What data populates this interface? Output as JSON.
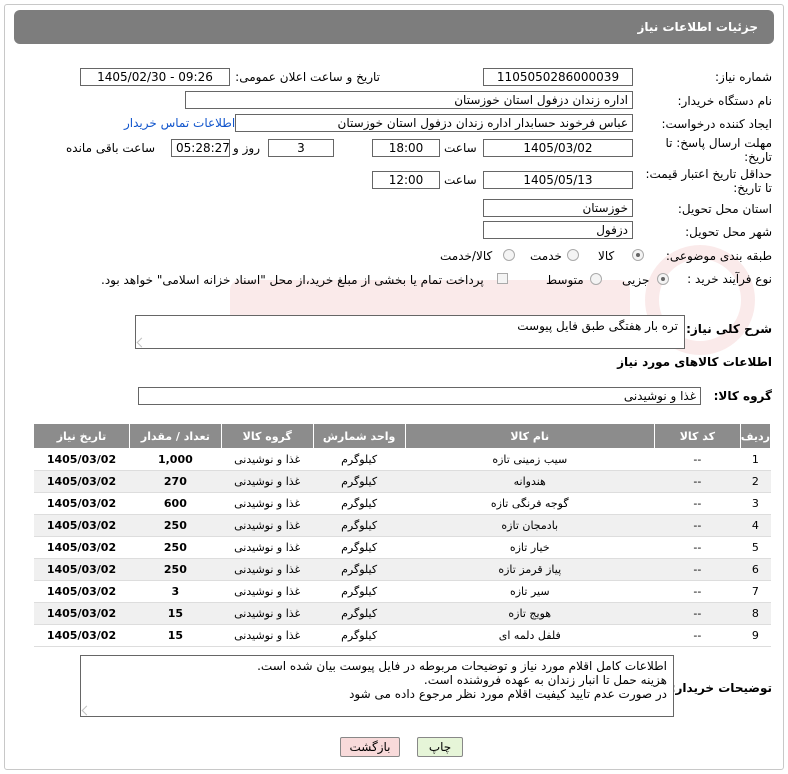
{
  "header": {
    "title": "جزئیات اطلاعات نیاز"
  },
  "fields": {
    "need_number_label": "شماره نیاز:",
    "need_number": "1105050286000039",
    "announce_label": "تاریخ و ساعت اعلان عمومی:",
    "announce_value": "1405/02/30 - 09:26",
    "buyer_label": "نام دستگاه خریدار:",
    "buyer_value": "اداره زندان دزفول استان خوزستان",
    "creator_label": "ایجاد کننده درخواست:",
    "creator_value": "عباس فرخوند حسابدار اداره زندان دزفول استان خوزستان",
    "contact_link": "اطلاعات تماس خریدار",
    "deadline_label_1": "مهلت ارسال پاسخ: تا",
    "deadline_label_2": "تاریخ:",
    "deadline_date": "1405/03/02",
    "time_label": "ساعت",
    "deadline_time": "18:00",
    "days_value": "3",
    "days_label": "روز و",
    "remaining_time": "05:28:27",
    "remaining_label": "ساعت باقی مانده",
    "validity_label_1": "حداقل تاریخ اعتبار قیمت:",
    "validity_label_2": "تا تاریخ:",
    "validity_date": "1405/05/13",
    "validity_time": "12:00",
    "province_label": "استان محل تحویل:",
    "province_value": "خوزستان",
    "city_label": "شهر محل تحویل:",
    "city_value": "دزفول",
    "category_label": "طبقه بندی موضوعی:",
    "category_options": [
      "کالا",
      "خدمت",
      "کالا/خدمت"
    ],
    "category_selected": "کالا",
    "process_label": "نوع فرآیند خرید :",
    "process_options": [
      "جزیی",
      "متوسط"
    ],
    "process_selected": "جزیی",
    "payment_note": "پرداخت تمام یا بخشی از مبلغ خرید،از محل \"اسناد خزانه اسلامی\" خواهد بود."
  },
  "summary": {
    "label": "شرح کلی نیاز:",
    "value": "تره بار هفتگی طبق فایل پیوست"
  },
  "goods_section": {
    "title": "اطلاعات کالاهای مورد نیاز",
    "group_label": "گروه کالا:",
    "group_value": "غذا و نوشیدنی"
  },
  "table": {
    "headers": [
      "ردیف",
      "کد کالا",
      "نام کالا",
      "واحد شمارش",
      "گروه کالا",
      "تعداد / مقدار",
      "تاریخ نیاز"
    ],
    "rows": [
      [
        "1",
        "--",
        "سیب زمینی تازه",
        "کیلوگرم",
        "غذا و نوشیدنی",
        "1,000",
        "1405/03/02"
      ],
      [
        "2",
        "--",
        "هندوانه",
        "کیلوگرم",
        "غذا و نوشیدنی",
        "270",
        "1405/03/02"
      ],
      [
        "3",
        "--",
        "گوجه فرنگی تازه",
        "کیلوگرم",
        "غذا و نوشیدنی",
        "600",
        "1405/03/02"
      ],
      [
        "4",
        "--",
        "بادمجان تازه",
        "کیلوگرم",
        "غذا و نوشیدنی",
        "250",
        "1405/03/02"
      ],
      [
        "5",
        "--",
        "خیار تازه",
        "کیلوگرم",
        "غذا و نوشیدنی",
        "250",
        "1405/03/02"
      ],
      [
        "6",
        "--",
        "پیاز قرمز تازه",
        "کیلوگرم",
        "غذا و نوشیدنی",
        "250",
        "1405/03/02"
      ],
      [
        "7",
        "--",
        "سیر تازه",
        "کیلوگرم",
        "غذا و نوشیدنی",
        "3",
        "1405/03/02"
      ],
      [
        "8",
        "--",
        "هویج تازه",
        "کیلوگرم",
        "غذا و نوشیدنی",
        "15",
        "1405/03/02"
      ],
      [
        "9",
        "--",
        "فلفل دلمه ای",
        "کیلوگرم",
        "غذا و نوشیدنی",
        "15",
        "1405/03/02"
      ]
    ]
  },
  "buyer_notes": {
    "label": "توضیحات خریدار:",
    "lines": [
      "اطلاعات کامل اقلام مورد نیاز و توضیحات مربوطه در فایل پیوست بیان شده است.",
      "هزینه حمل تا انبار زندان به عهده فروشنده است.",
      "در صورت عدم تایید کیفیت اقلام مورد نظر مرجوع داده می شود"
    ]
  },
  "buttons": {
    "print": "چاپ",
    "back": "بازگشت"
  },
  "colors": {
    "header_bg": "#7d7d7d",
    "table_header_bg": "#8c8c8c",
    "back_btn_bg": "#f8dada",
    "print_btn_bg": "#e6f5d8",
    "link": "#1155cc"
  }
}
